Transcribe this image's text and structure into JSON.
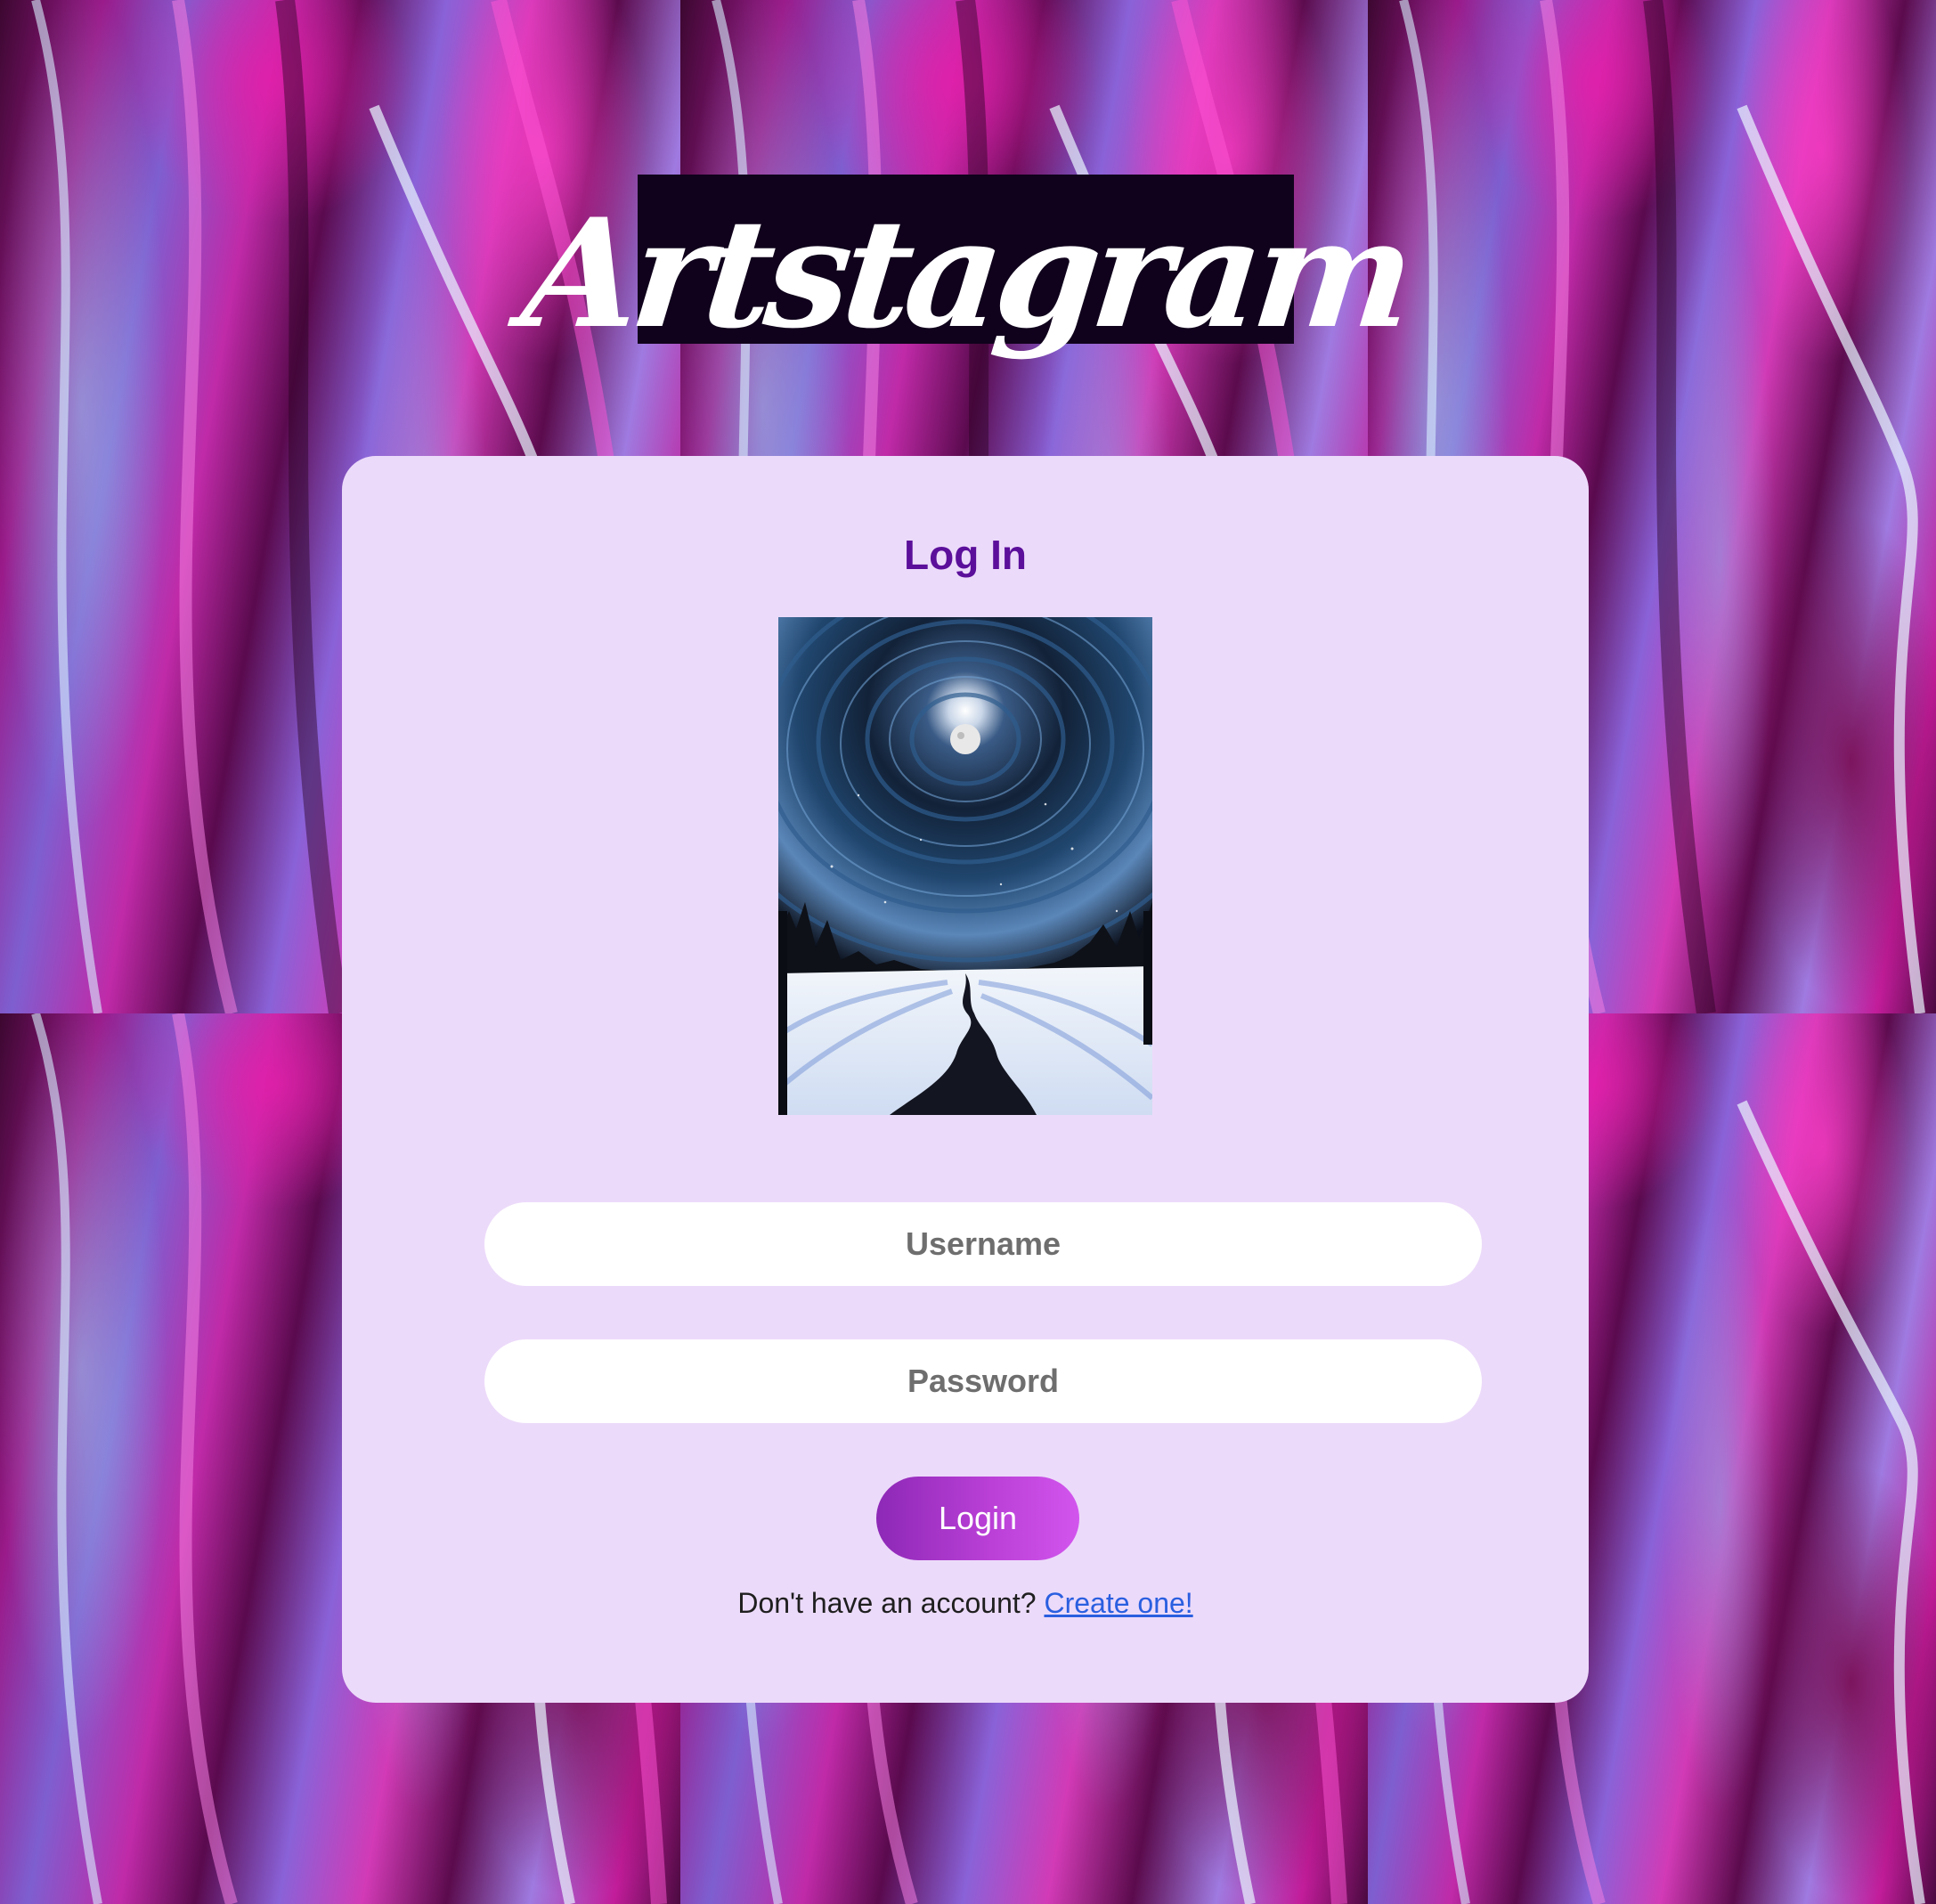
{
  "logo": {
    "text": "Artstagram"
  },
  "login_card": {
    "title": "Log In",
    "artwork_alt": "Night painting of a swirling moonlit sky above a snowy path between pine trees",
    "username_placeholder": "Username",
    "password_placeholder": "Password",
    "login_button": "Login",
    "signup_prompt": "Don't have an account?",
    "signup_link": "Create one!"
  },
  "colors": {
    "card_background": "#ecdafa",
    "title_color": "#5b0f9a",
    "logo_background": "#10021c",
    "button_gradient_start": "#8d28b6",
    "button_gradient_end": "#d255ee",
    "link_color": "#2a5fe0"
  }
}
